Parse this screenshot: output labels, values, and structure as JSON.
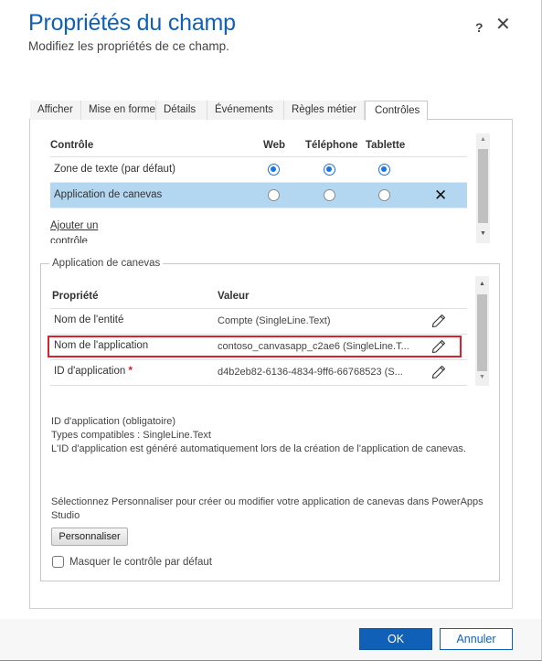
{
  "header": {
    "title": "Propriétés du champ",
    "subtitle": "Modifiez les propriétés de ce champ.",
    "help_label": "?",
    "close_label": "✕"
  },
  "tabs": [
    {
      "label": "Afficher",
      "active": false
    },
    {
      "label": "Mise en forme",
      "active": false
    },
    {
      "label": "Détails",
      "active": false
    },
    {
      "label": "Événements",
      "active": false
    },
    {
      "label": "Règles métier",
      "active": false
    },
    {
      "label": "Contrôles",
      "active": true
    }
  ],
  "controls": {
    "columns": [
      "Contrôle",
      "Web",
      "Téléphone",
      "Tablette"
    ],
    "rows": [
      {
        "label": "Zone de texte (par défaut)",
        "web": true,
        "phone": true,
        "tablet": true,
        "selected": false,
        "removable": false
      },
      {
        "label": "Application de canevas",
        "web": false,
        "phone": false,
        "tablet": false,
        "selected": true,
        "removable": true
      }
    ],
    "remove_icon": "✕",
    "add_link": "Ajouter un contrôle"
  },
  "canvas_app": {
    "legend": "Application de canevas",
    "columns": [
      "Propriété",
      "Valeur"
    ],
    "properties": [
      {
        "name": "Nom de l'entité",
        "value": "Compte (SingleLine.Text)",
        "required": false,
        "highlighted": false
      },
      {
        "name": "Nom de l'application",
        "value": "contoso_canvasapp_c2ae6 (SingleLine.T...",
        "required": false,
        "highlighted": true
      },
      {
        "name": "ID d'application",
        "value": "d4b2eb82-6136-4834-9ff6-66768523 (S...",
        "required": true,
        "highlighted": false
      }
    ],
    "required_marker": "*",
    "info_lines": [
      "ID d'application (obligatoire)",
      "Types compatibles : SingleLine.Text",
      "L'ID d'application est généré automatiquement lors de la création de l'application de canevas."
    ],
    "customize_hint": "Sélectionnez Personnaliser pour créer ou modifier votre application de canevas dans PowerApps Studio",
    "customize_button": "Personnaliser",
    "hide_default_label": "Masquer le contrôle par défaut",
    "hide_default_checked": false
  },
  "footer": {
    "ok_label": "OK",
    "cancel_label": "Annuler"
  },
  "colors": {
    "accent": "#1160b7",
    "selected_row": "#b3d7f0",
    "radio_on": "#1a73e8",
    "highlight_border": "#d6232f"
  }
}
